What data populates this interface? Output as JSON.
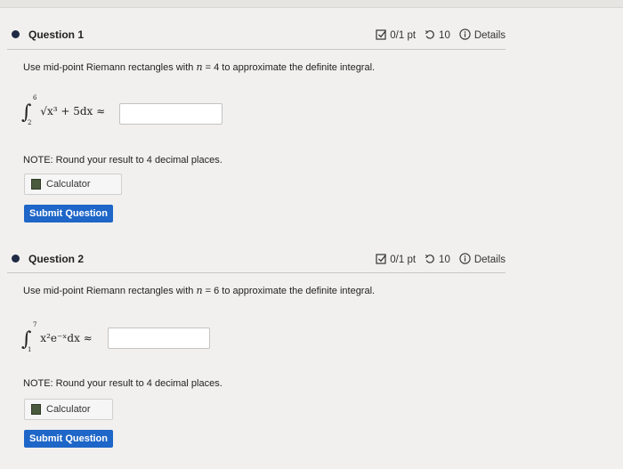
{
  "questions": [
    {
      "title": "Question 1",
      "score": "0/1 pt",
      "attempts": "10",
      "details_label": "Details",
      "prompt_before": "Use mid-point Riemann rectangles with",
      "prompt_var": "n",
      "prompt_eq": " = ",
      "prompt_n": "4",
      "prompt_after": " to approximate the definite integral.",
      "integral_upper": "6",
      "integral_lower": "2",
      "integrand": "√x³ + 5dx ≈",
      "note": "NOTE: Round your result to 4 decimal places.",
      "calculator_label": "Calculator",
      "submit_label": "Submit Question"
    },
    {
      "title": "Question 2",
      "score": "0/1 pt",
      "attempts": "10",
      "details_label": "Details",
      "prompt_before": "Use mid-point Riemann rectangles with",
      "prompt_var": "n",
      "prompt_eq": " = ",
      "prompt_n": "6",
      "prompt_after": " to approximate the definite integral.",
      "integral_upper": "7",
      "integral_lower": "1",
      "integrand": "x²e⁻ˣdx ≈",
      "note": "NOTE: Round your result to 4 decimal places.",
      "calculator_label": "Calculator",
      "submit_label": "Submit Question"
    }
  ]
}
